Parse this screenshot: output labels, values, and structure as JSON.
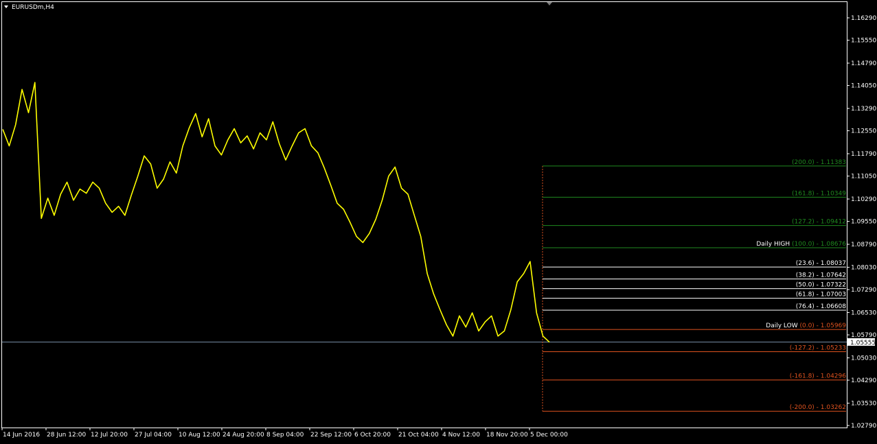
{
  "window": {
    "symbol_label": "EURUSDm,H4",
    "menu_icon": "triangle-down-icon",
    "colors": {
      "background": "#000000",
      "frame": "#ffffff",
      "price_line": "#ffff00",
      "bid_line": "#7a8fa8"
    }
  },
  "chart_data": {
    "type": "line",
    "symbol": "EURUSDm",
    "timeframe": "H4",
    "current_price": "1.05555",
    "ylim": [
      1.0279,
      1.1629
    ],
    "y_ticks": [
      "1.16290",
      "1.15550",
      "1.14790",
      "1.14050",
      "1.13290",
      "1.12550",
      "1.11790",
      "1.11050",
      "1.10290",
      "1.09550",
      "1.08790",
      "1.08030",
      "1.07290",
      "1.06530",
      "1.05790",
      "1.05030",
      "1.04290",
      "1.03530",
      "1.02790"
    ],
    "x_ticks": [
      "14 Jun 2016",
      "28 Jun 12:00",
      "12 Jul 20:00",
      "27 Jul 04:00",
      "10 Aug 12:00",
      "24 Aug 20:00",
      "8 Sep 04:00",
      "22 Sep 12:00",
      "6 Oct 20:00",
      "21 Oct 04:00",
      "4 Nov 12:00",
      "18 Nov 20:00",
      "5 Dec 00:00"
    ],
    "series": [
      {
        "values": [
          1.126,
          1.1205,
          1.1275,
          1.1392,
          1.1315,
          1.1415,
          1.0965,
          1.1032,
          1.0975,
          1.1045,
          1.1085,
          1.1025,
          1.1062,
          1.1048,
          1.1085,
          1.1065,
          1.1015,
          1.0985,
          1.1005,
          1.0975,
          1.1042,
          1.1105,
          1.1172,
          1.1145,
          1.1065,
          1.1095,
          1.1152,
          1.1115,
          1.1205,
          1.1265,
          1.1312,
          1.1235,
          1.1295,
          1.1205,
          1.1175,
          1.1225,
          1.1262,
          1.1215,
          1.1238,
          1.1195,
          1.1248,
          1.1225,
          1.1285,
          1.1212,
          1.1158,
          1.1205,
          1.1248,
          1.1262,
          1.1205,
          1.1182,
          1.1132,
          1.1075,
          1.1015,
          1.0995,
          1.0952,
          1.0905,
          1.0885,
          1.0915,
          1.0962,
          1.1025,
          1.1105,
          1.1135,
          1.1065,
          1.1045,
          1.0975,
          1.0905,
          1.0782,
          1.0715,
          1.0662,
          1.0612,
          1.0575,
          1.0642,
          1.0605,
          1.0652,
          1.0592,
          1.0622,
          1.0642,
          1.0575,
          1.0592,
          1.0662,
          1.0755,
          1.0782,
          1.0822,
          1.0652,
          1.0575,
          1.0555
        ]
      }
    ],
    "fibonacci": {
      "levels": [
        {
          "label": "(200.0) -  1.11383",
          "prefix": "",
          "price": 1.11383,
          "color": "#1f8a1f"
        },
        {
          "label": "(161.8) -  1.10349",
          "prefix": "",
          "price": 1.10349,
          "color": "#1f8a1f"
        },
        {
          "label": "(127.2) -  1.09412",
          "prefix": "",
          "price": 1.09412,
          "color": "#1f8a1f"
        },
        {
          "label": "(100.0) -  1.08676",
          "prefix": "Daily HIGH ",
          "price": 1.08676,
          "color": "#1f8a1f"
        },
        {
          "label": "(23.6) -  1.08037",
          "prefix": "",
          "price": 1.08037,
          "color": "#ffffff"
        },
        {
          "label": "(38.2) -  1.07642",
          "prefix": "",
          "price": 1.07642,
          "color": "#ffffff"
        },
        {
          "label": "(50.0) -  1.07322",
          "prefix": "",
          "price": 1.07322,
          "color": "#ffffff"
        },
        {
          "label": "(61.8) -  1.07003",
          "prefix": "",
          "price": 1.07003,
          "color": "#ffffff"
        },
        {
          "label": "(76.4) -  1.06608",
          "prefix": "",
          "price": 1.06608,
          "color": "#ffffff"
        },
        {
          "label": "(0.0) -  1.05969",
          "prefix": "Daily LOW ",
          "price": 1.05969,
          "color": "#e0531f"
        },
        {
          "label": "(-127.2) -  1.05233",
          "prefix": "",
          "price": 1.05233,
          "color": "#e0531f"
        },
        {
          "label": "(-161.8) -  1.04296",
          "prefix": "",
          "price": 1.04296,
          "color": "#e0531f"
        },
        {
          "label": "(-200.0) -  1.03262",
          "prefix": "",
          "price": 1.03262,
          "color": "#e0531f"
        }
      ]
    }
  }
}
